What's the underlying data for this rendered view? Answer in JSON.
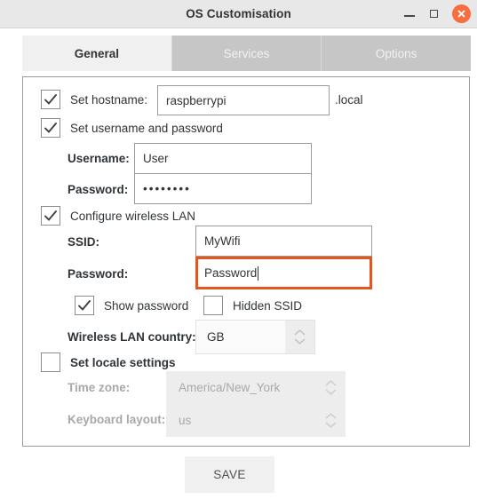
{
  "window": {
    "title": "OS Customisation",
    "controls": {
      "minimize": "minimize-icon",
      "maximize": "maximize-icon",
      "close": "close-icon",
      "close_color": "#f96c3d"
    }
  },
  "tabs": [
    {
      "label": "General",
      "active": true
    },
    {
      "label": "Services",
      "active": false
    },
    {
      "label": "Options",
      "active": false
    }
  ],
  "form": {
    "hostname": {
      "checkbox_label": "Set hostname:",
      "checked": true,
      "value": "raspberrypi",
      "placeholder": "",
      "suffix": ".local"
    },
    "user": {
      "checkbox_label": "Set username and password",
      "checked": true,
      "username_label": "Username:",
      "username_value": "User",
      "password_label": "Password:",
      "password_value": "••••••••"
    },
    "wireless": {
      "checkbox_label": "Configure wireless LAN",
      "checked": true,
      "ssid_label": "SSID:",
      "ssid_value": "MyWifi",
      "password_label": "Password:",
      "password_value": "Password",
      "password_focused": true,
      "focus_color": "#e2561f",
      "show_password_label": "Show password",
      "show_password_checked": true,
      "hidden_ssid_label": "Hidden SSID",
      "hidden_ssid_checked": false,
      "country_label": "Wireless LAN country:",
      "country_value": "GB"
    },
    "locale": {
      "checkbox_label": "Set locale settings",
      "checked": false,
      "enabled": false,
      "timezone_label": "Time zone:",
      "timezone_value": "America/New_York",
      "keyboard_label": "Keyboard layout:",
      "keyboard_value": "us"
    }
  },
  "footer": {
    "save_label": "SAVE"
  }
}
